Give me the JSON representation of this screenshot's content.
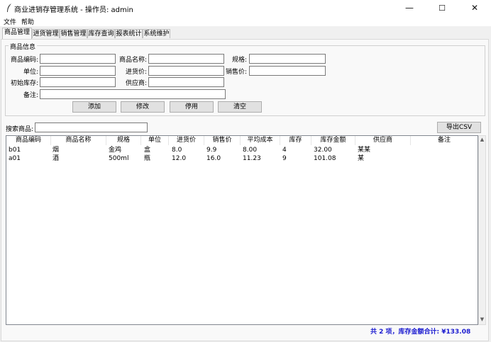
{
  "window": {
    "title": "商业进销存管理系统 - 操作员: admin",
    "minimize": "—",
    "maximize": "☐",
    "close": "✕"
  },
  "menu": [
    "文件",
    "帮助"
  ],
  "tabs": [
    "商品管理",
    "进货管理",
    "销售管理",
    "库存查询",
    "报表统计",
    "系统维护"
  ],
  "form": {
    "group_title": "商品信息",
    "labels": {
      "code": "商品编码:",
      "name": "商品名称:",
      "spec": "规格:",
      "unit": "单位:",
      "purchase_price": "进货价:",
      "sale_price": "销售价:",
      "initial_stock": "初始库存:",
      "supplier": "供应商:",
      "note": "备注:"
    },
    "values": {
      "code": "",
      "name": "",
      "spec": "",
      "unit": "",
      "purchase_price": "",
      "sale_price": "",
      "initial_stock": "",
      "supplier": "",
      "note": ""
    },
    "buttons": {
      "add": "添加",
      "edit": "修改",
      "disable": "停用",
      "clear": "清空"
    }
  },
  "search": {
    "label": "搜索商品:",
    "value": "",
    "export": "导出CSV"
  },
  "table": {
    "columns": [
      "商品编码",
      "商品名称",
      "规格",
      "单位",
      "进货价",
      "销售价",
      "平均成本",
      "库存",
      "库存金额",
      "供应商",
      "备注"
    ],
    "rows": [
      [
        "b01",
        "烟",
        "金鸡",
        "盒",
        "8.0",
        "9.9",
        "8.00",
        "4",
        "32.00",
        "某某",
        ""
      ],
      [
        "a01",
        "酒",
        "500ml",
        "瓶",
        "12.0",
        "16.0",
        "11.23",
        "9",
        "101.08",
        "某",
        ""
      ]
    ]
  },
  "footer": {
    "summary": "共 2 项，库存金额合计: ¥133.08"
  },
  "colors": {
    "accent_text": "#1a1ad0",
    "panel_bg": "#f9f9f9",
    "window_bg": "#f0f0f0"
  }
}
